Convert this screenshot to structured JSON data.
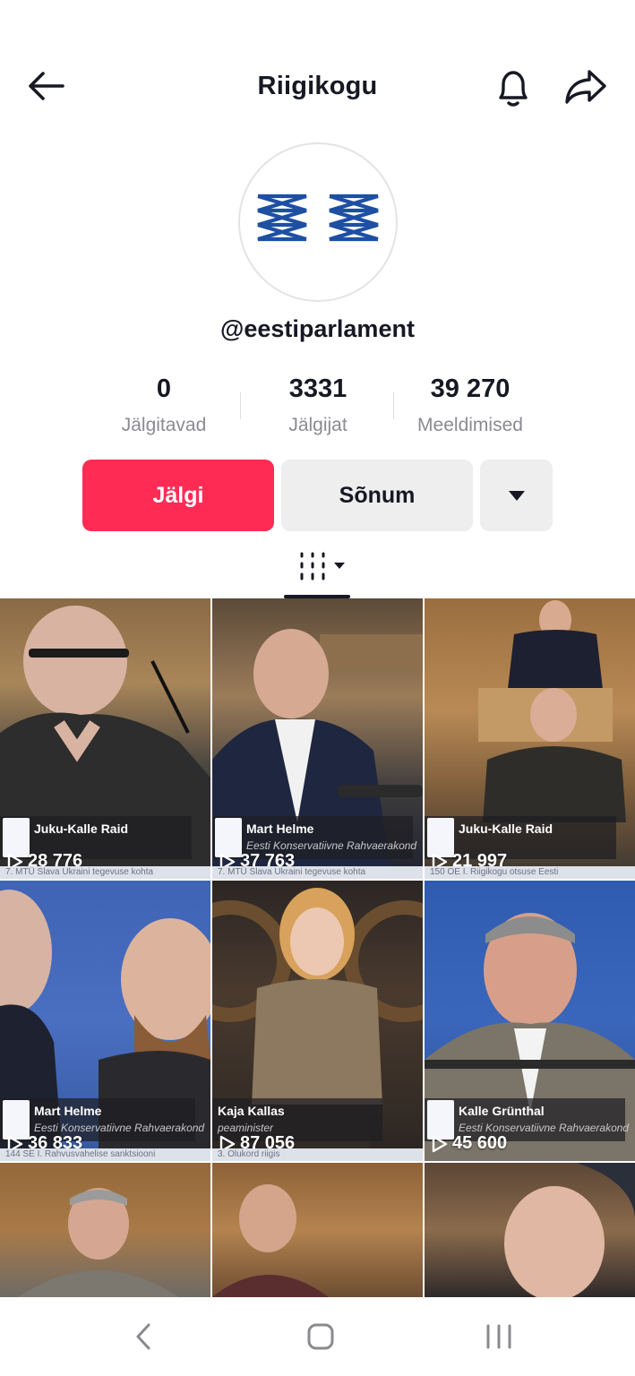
{
  "header": {
    "title": "Riigikogu",
    "back_icon": "arrow-left-icon",
    "bell_icon": "bell-icon",
    "share_icon": "share-arrow-icon"
  },
  "profile": {
    "handle": "@eestiparlament",
    "avatar_color": "#1e4fa3"
  },
  "stats": [
    {
      "value": "0",
      "label": "Jälgitavad"
    },
    {
      "value": "3331",
      "label": "Jälgijat"
    },
    {
      "value": "39 270",
      "label": "Meeldimised"
    }
  ],
  "actions": {
    "follow_label": "Jälgi",
    "message_label": "Sõnum",
    "more_icon": "caret-down-icon",
    "follow_color": "#fe2c55"
  },
  "tabs": {
    "active": "videos-grid-icon"
  },
  "videos": [
    {
      "name": "Juku-Kalle Raid",
      "party": "",
      "views": "28 776",
      "ticker": "7. MTÜ Slava Ukraini tegevuse kohta"
    },
    {
      "name": "Mart Helme",
      "party": "Eesti Konservatiivne Rahvaerakond",
      "views": "37 763",
      "ticker": "7. MTÜ Slava Ukraini tegevuse kohta"
    },
    {
      "name": "Juku-Kalle Raid",
      "party": "",
      "views": "21 997",
      "ticker": "150 OE I. Riigikogu otsuse Eesti"
    },
    {
      "name": "Mart Helme",
      "party": "Eesti Konservatiivne Rahvaerakond",
      "views": "36 833",
      "ticker": "144 SE I. Rahvusvahelise sanktsiooni"
    },
    {
      "name": "Kaja Kallas",
      "party": "peaminister",
      "views": "87 056",
      "ticker": "3. Olukord riigis"
    },
    {
      "name": "Kalle Grünthal",
      "party": "Eesti Konservatiivne Rahvaerakond",
      "views": "45 600",
      "ticker": ""
    },
    {
      "name": "",
      "party": "",
      "views": "",
      "ticker": ""
    },
    {
      "name": "",
      "party": "",
      "views": "",
      "ticker": ""
    },
    {
      "name": "",
      "party": "",
      "views": "",
      "ticker": ""
    }
  ],
  "system_nav": {
    "back_icon": "nav-back-icon",
    "home_icon": "nav-home-icon",
    "recents_icon": "nav-recents-icon"
  }
}
